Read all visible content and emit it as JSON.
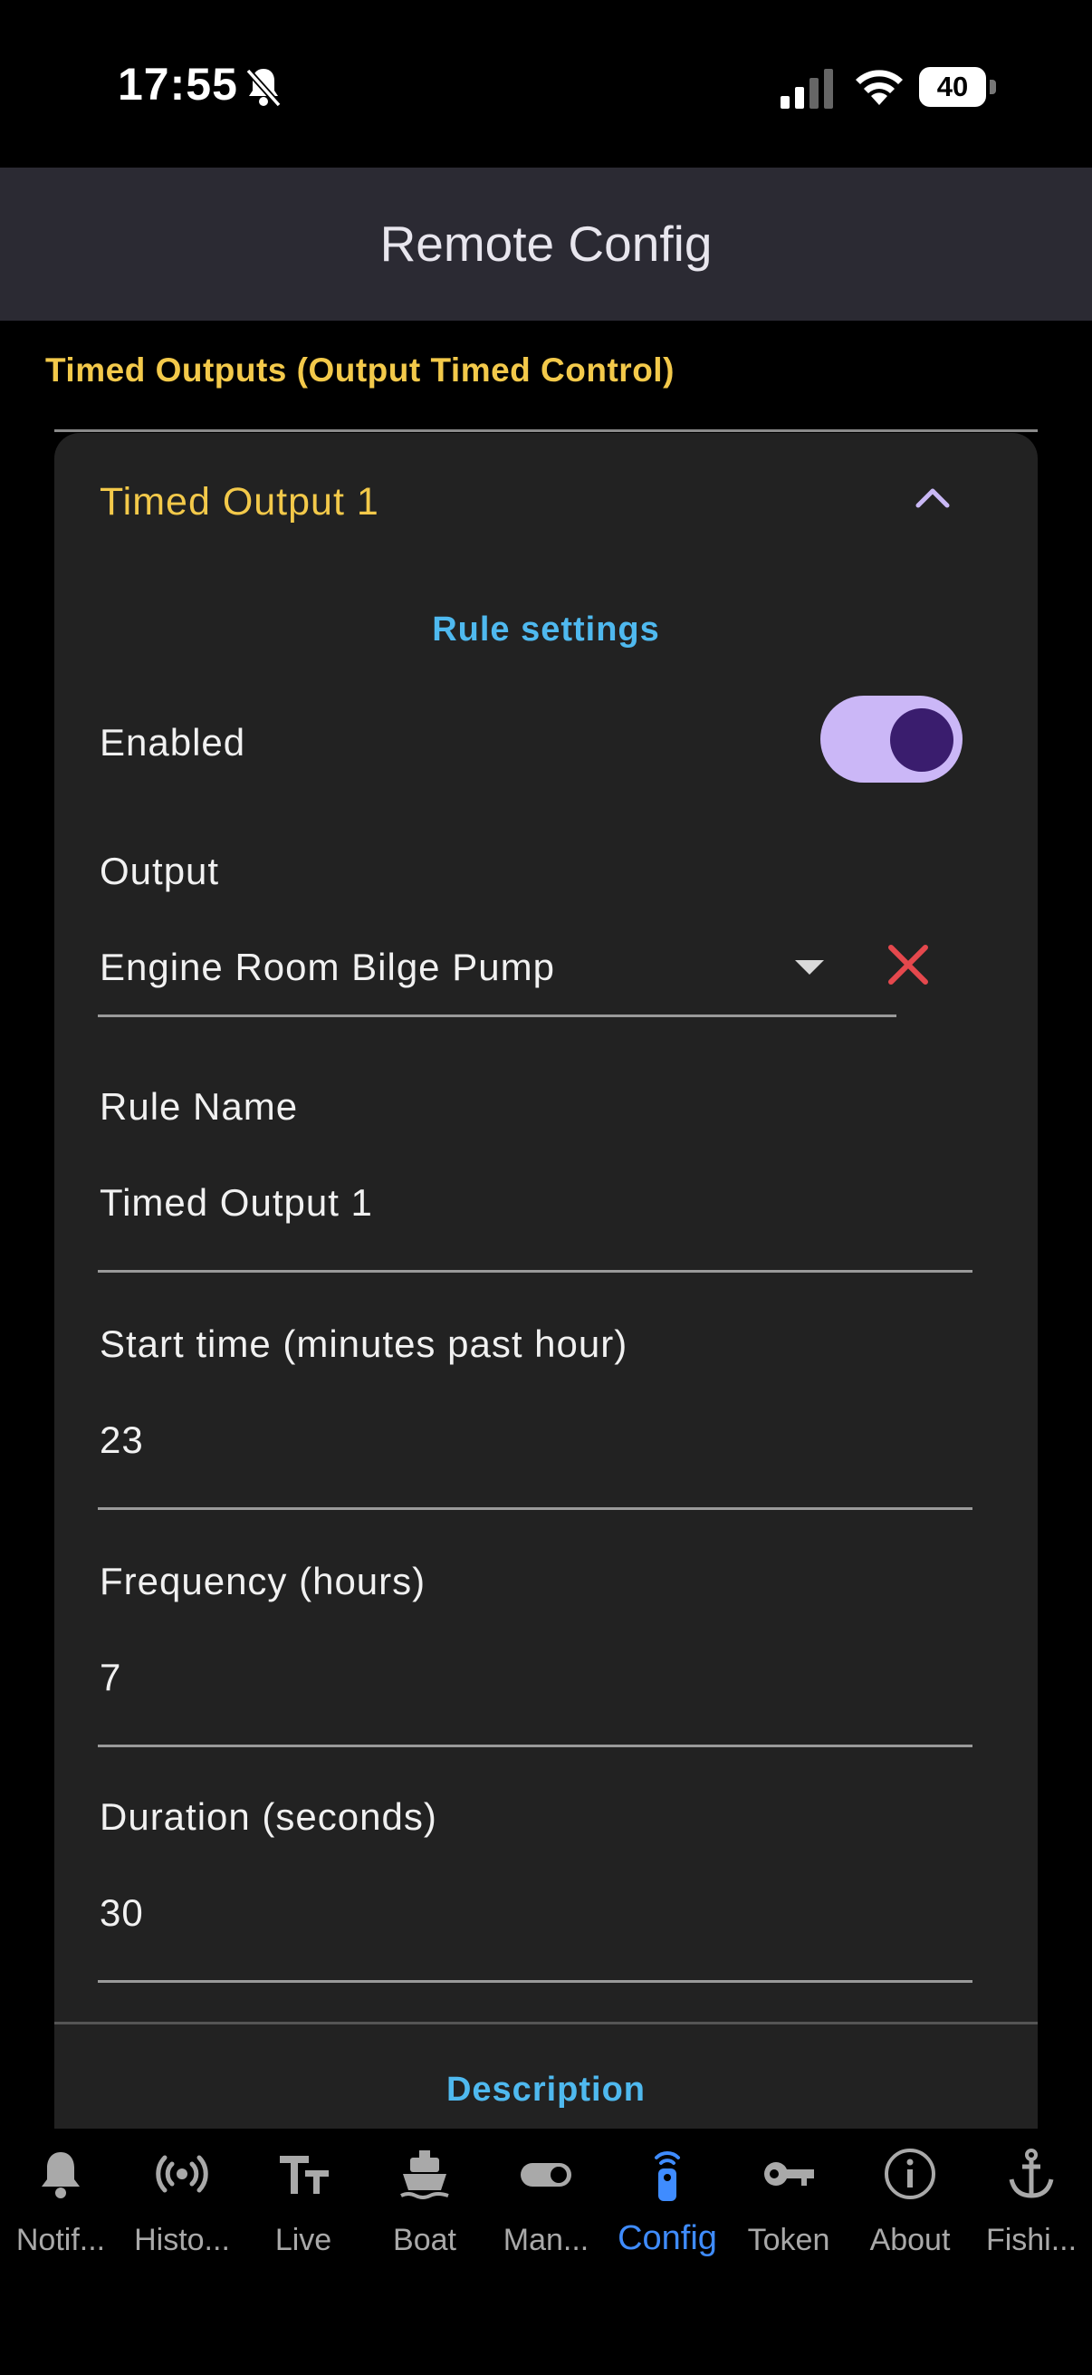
{
  "status_bar": {
    "time": "17:55",
    "battery": "40"
  },
  "app_bar": {
    "title": "Remote Config"
  },
  "section": {
    "title": "Timed Outputs (Output Timed Control)"
  },
  "card": {
    "title": "Timed Output 1",
    "rule_settings_heading": "Rule settings",
    "enabled": {
      "label": "Enabled",
      "value": true
    },
    "output": {
      "label": "Output",
      "selected": "Engine Room Bilge Pump"
    },
    "rule_name": {
      "label": "Rule Name",
      "value": "Timed Output 1"
    },
    "start_time": {
      "label": "Start time (minutes past hour)",
      "value": "23"
    },
    "frequency": {
      "label": "Frequency (hours)",
      "value": "7"
    },
    "duration": {
      "label": "Duration (seconds)",
      "value": "30"
    },
    "description_heading": "Description"
  },
  "colors": {
    "accent_yellow": "#f3c94a",
    "accent_blue": "#4fb9ef",
    "nav_active": "#3f8cff",
    "toggle_track": "#cbb7f7",
    "clear_red": "#e5484d"
  },
  "nav": {
    "items": [
      {
        "label": "Notif...",
        "icon": "bell-icon"
      },
      {
        "label": "Histo...",
        "icon": "broadcast-icon"
      },
      {
        "label": "Live",
        "icon": "text-size-icon"
      },
      {
        "label": "Boat",
        "icon": "ship-icon"
      },
      {
        "label": "Man...",
        "icon": "toggle-icon"
      },
      {
        "label": "Config",
        "icon": "remote-icon",
        "active": true
      },
      {
        "label": "Token",
        "icon": "key-icon"
      },
      {
        "label": "About",
        "icon": "info-icon"
      },
      {
        "label": "Fishi...",
        "icon": "anchor-icon"
      }
    ]
  }
}
